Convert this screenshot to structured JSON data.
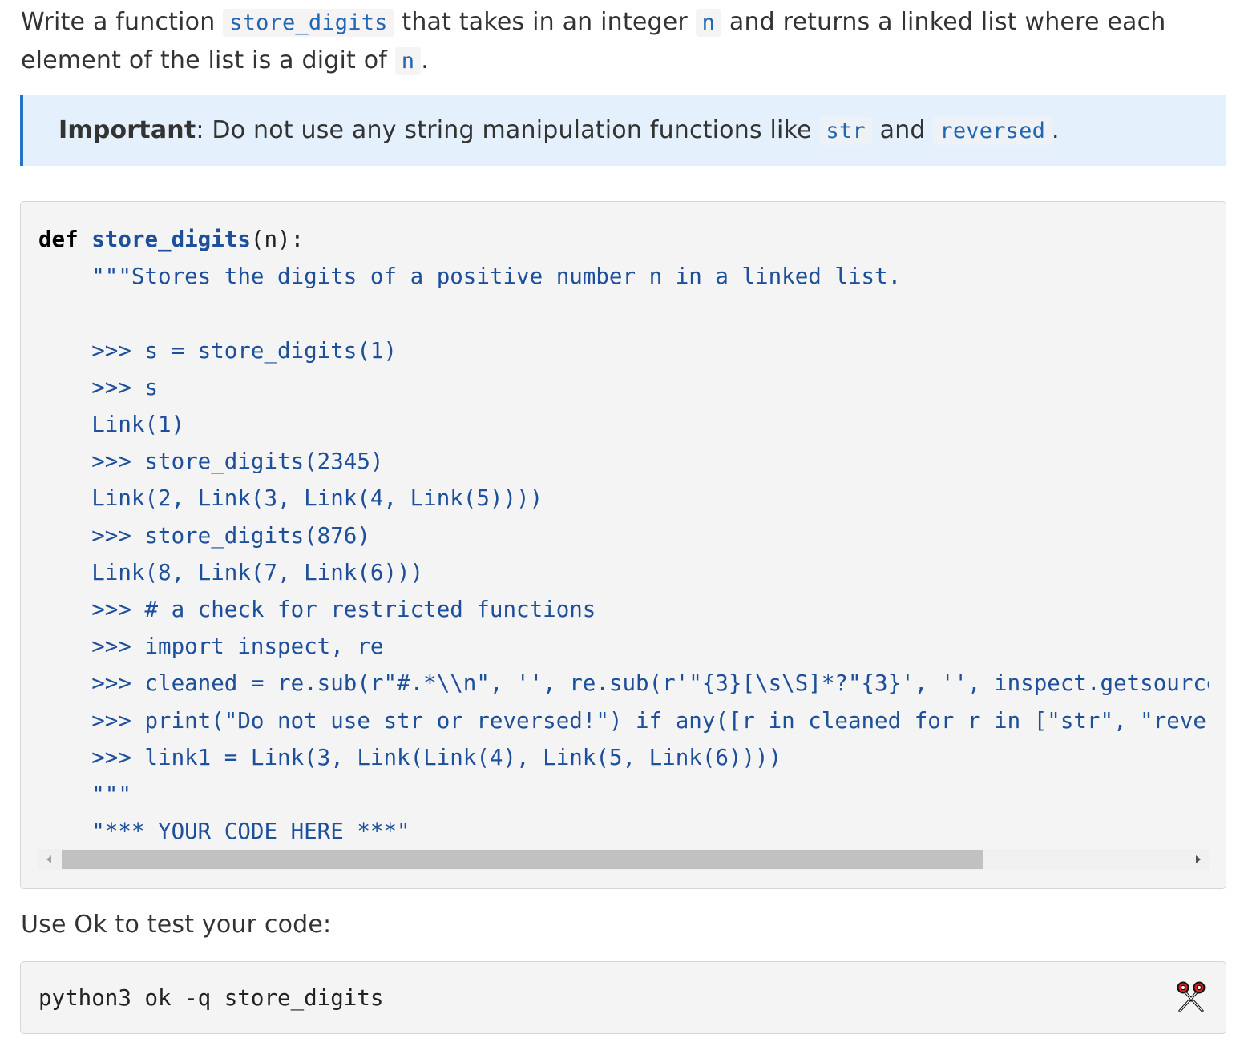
{
  "intro": {
    "p1": "Write a function ",
    "code1": "store_digits",
    "p2": " that takes in an integer ",
    "code2": "n",
    "p3": " and returns a linked list where each element of the list is a digit of ",
    "code3": "n",
    "p4": "."
  },
  "important": {
    "label": "Important",
    "p1": ": Do not use any string manipulation functions like ",
    "code1": "str",
    "p2": " and ",
    "code2": "reversed",
    "p3": "."
  },
  "code": {
    "def_kw": "def",
    "fn_name": "store_digits",
    "signature_rest": "(n):",
    "docstring_lines": [
      "    \"\"\"Stores the digits of a positive number n in a linked list.",
      "",
      "    >>> s = store_digits(1)",
      "    >>> s",
      "    Link(1)",
      "    >>> store_digits(2345)",
      "    Link(2, Link(3, Link(4, Link(5))))",
      "    >>> store_digits(876)",
      "    Link(8, Link(7, Link(6)))",
      "    >>> # a check for restricted functions",
      "    >>> import inspect, re",
      "    >>> cleaned = re.sub(r\"#.*\\\\n\", '', re.sub(r'\"{3}[\\s\\S]*?\"{3}', '', inspect.getsource(store_digits)))",
      "    >>> print(\"Do not use str or reversed!\") if any([r in cleaned for r in [\"str\", \"reversed\"]]) else None",
      "    >>> link1 = Link(3, Link(Link(4), Link(5, Link(6))))",
      "    \"\"\"",
      "    \"*** YOUR CODE HERE ***\""
    ]
  },
  "scrollbar": {
    "thumb_fraction": 0.82,
    "position_fraction": 0.0
  },
  "ok_section": {
    "text": "Use Ok to test your code:",
    "command": "python3 ok -q store_digits",
    "copy_icon": "scissors-icon"
  }
}
